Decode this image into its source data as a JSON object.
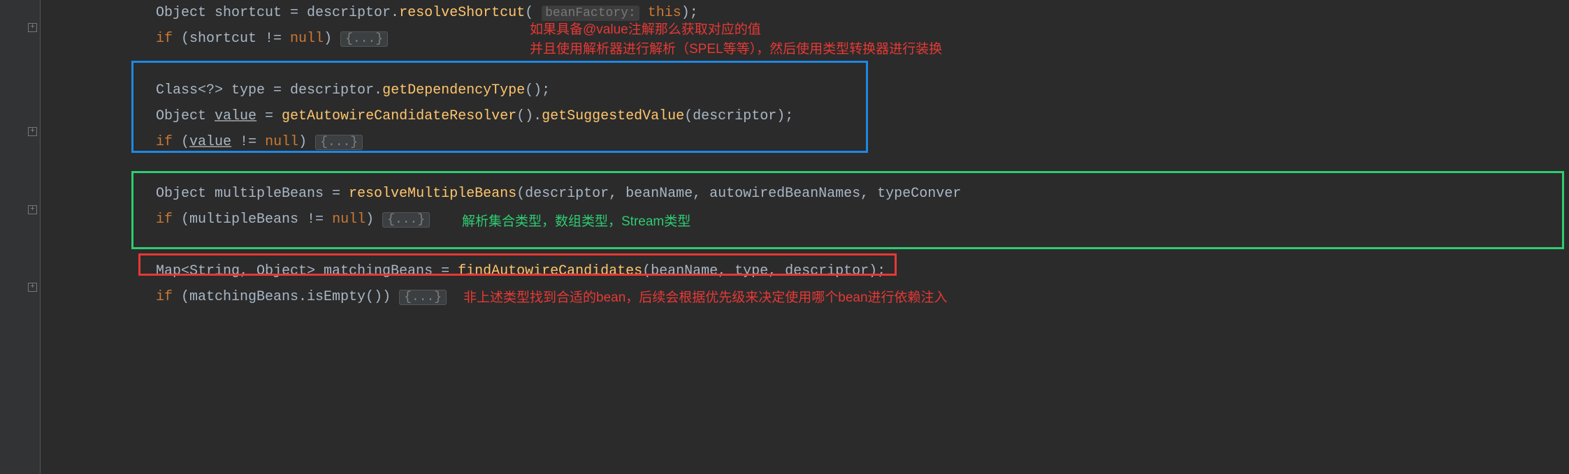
{
  "code": {
    "line1": {
      "pre": "Object shortcut = descriptor.",
      "method": "resolveShortcut",
      "hint": "beanFactory:",
      "thiskw": "this"
    },
    "line2": {
      "kw": "if",
      "cond": " (shortcut != ",
      "nullkw": "null",
      "close": ") ",
      "fold": "{...}"
    },
    "line4": {
      "pre": "Class<?> type = descriptor.",
      "method": "getDependencyType",
      "tail": "();"
    },
    "line5": {
      "pre1": "Object ",
      "value": "value",
      "pre2": " = ",
      "method1": "getAutowireCandidateResolver",
      "mid": "().",
      "method2": "getSuggestedValue",
      "tail": "(descriptor);"
    },
    "line6": {
      "kw": "if",
      "open": " (",
      "value": "value",
      "cond": " != ",
      "nullkw": "null",
      "close": ") ",
      "fold": "{...}"
    },
    "line8": {
      "pre": "Object multipleBeans = ",
      "method": "resolveMultipleBeans",
      "tail": "(descriptor, beanName, autowiredBeanNames, typeConver"
    },
    "line9": {
      "kw": "if",
      "cond": " (multipleBeans != ",
      "nullkw": "null",
      "close": ") ",
      "fold": "{...}"
    },
    "line11": {
      "pre": "Map<String, Object> matchingBeans = ",
      "method": "findAutowireCandidates",
      "tail": "(beanName, type, descriptor);"
    },
    "line12": {
      "kw": "if",
      "cond": " (matchingBeans.isEmpty()) ",
      "fold": "{...}"
    }
  },
  "annotations": {
    "red1": "如果具备@value注解那么获取对应的值",
    "red2": "并且使用解析器进行解析（SPEL等等），然后使用类型转换器进行装换",
    "green1": "解析集合类型，数组类型，Stream类型",
    "red3": "非上述类型找到合适的bean，后续会根据优先级来决定使用哪个bean进行依赖注入"
  }
}
